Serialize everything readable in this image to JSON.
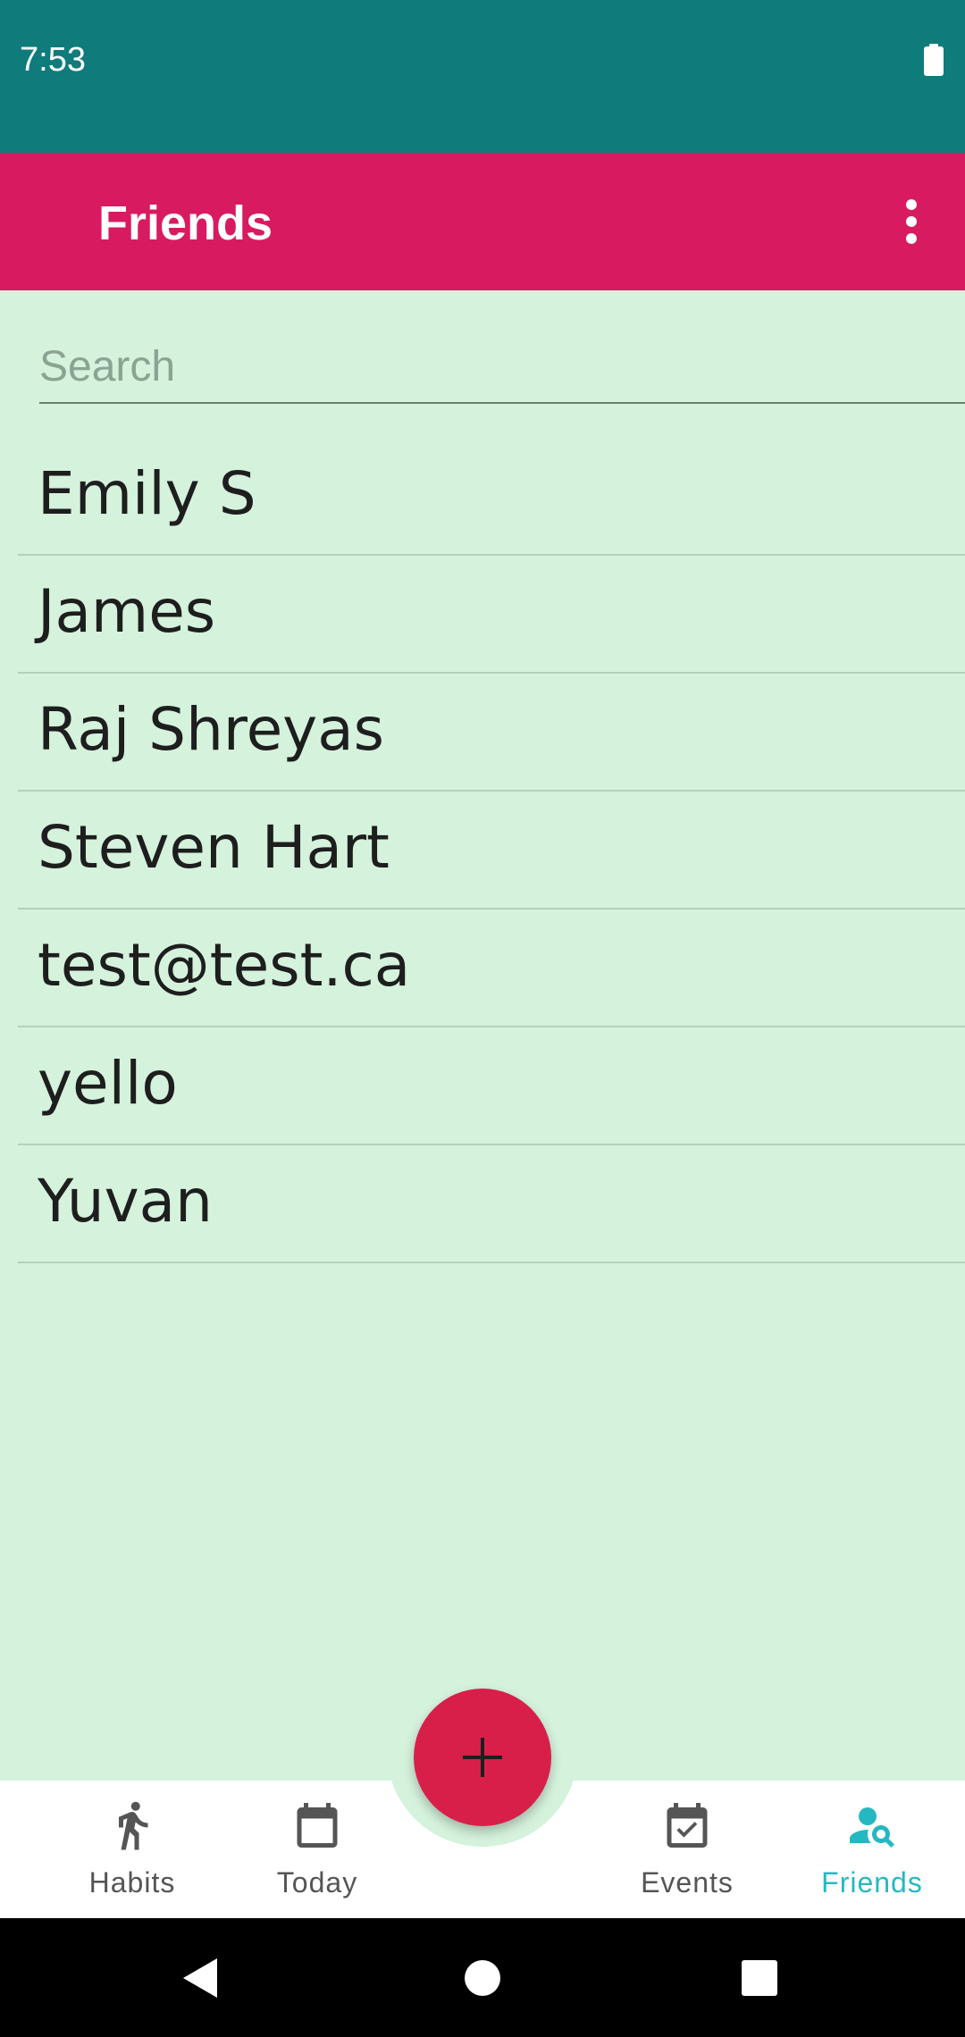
{
  "status_bar": {
    "time": "7:53",
    "battery_icon": "battery-full-icon"
  },
  "app_bar": {
    "title": "Friends",
    "menu_icon": "more-vert-icon"
  },
  "search": {
    "placeholder": "Search",
    "value": ""
  },
  "friends": [
    {
      "name": "Emily S"
    },
    {
      "name": "James"
    },
    {
      "name": "Raj Shreyas"
    },
    {
      "name": "Steven Hart"
    },
    {
      "name": "test@test.ca"
    },
    {
      "name": "yello"
    },
    {
      "name": "Yuvan"
    }
  ],
  "fab": {
    "icon": "plus-icon",
    "label": "+"
  },
  "bottom_nav": {
    "items": [
      {
        "label": "Habits",
        "icon": "running-person-icon"
      },
      {
        "label": "Today",
        "icon": "calendar-icon"
      },
      {
        "label": "Events",
        "icon": "calendar-check-icon"
      },
      {
        "label": "Friends",
        "icon": "person-search-icon",
        "active": true
      }
    ]
  },
  "system_nav": {
    "back": "back-icon",
    "home": "home-icon",
    "recents": "recents-icon"
  },
  "colors": {
    "status_bar": "#0f7b7b",
    "app_bar": "#d81b60",
    "background": "#d4f2dc",
    "fab": "#d81f4a",
    "active_nav": "#26b8c2"
  }
}
